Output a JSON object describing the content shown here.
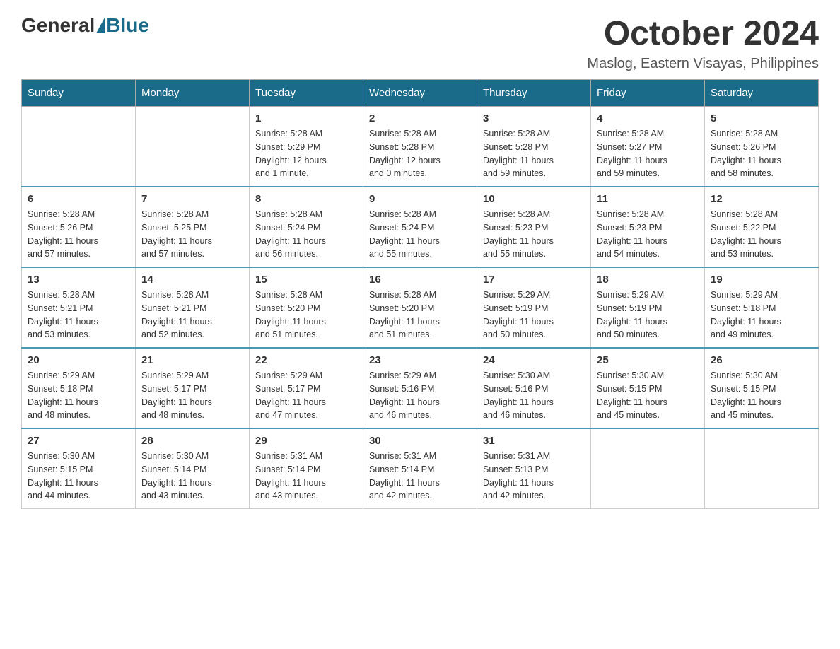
{
  "header": {
    "logo_general": "General",
    "logo_blue": "Blue",
    "month_year": "October 2024",
    "location": "Maslog, Eastern Visayas, Philippines"
  },
  "days_of_week": [
    "Sunday",
    "Monday",
    "Tuesday",
    "Wednesday",
    "Thursday",
    "Friday",
    "Saturday"
  ],
  "weeks": [
    [
      {
        "day": "",
        "info": ""
      },
      {
        "day": "",
        "info": ""
      },
      {
        "day": "1",
        "info": "Sunrise: 5:28 AM\nSunset: 5:29 PM\nDaylight: 12 hours\nand 1 minute."
      },
      {
        "day": "2",
        "info": "Sunrise: 5:28 AM\nSunset: 5:28 PM\nDaylight: 12 hours\nand 0 minutes."
      },
      {
        "day": "3",
        "info": "Sunrise: 5:28 AM\nSunset: 5:28 PM\nDaylight: 11 hours\nand 59 minutes."
      },
      {
        "day": "4",
        "info": "Sunrise: 5:28 AM\nSunset: 5:27 PM\nDaylight: 11 hours\nand 59 minutes."
      },
      {
        "day": "5",
        "info": "Sunrise: 5:28 AM\nSunset: 5:26 PM\nDaylight: 11 hours\nand 58 minutes."
      }
    ],
    [
      {
        "day": "6",
        "info": "Sunrise: 5:28 AM\nSunset: 5:26 PM\nDaylight: 11 hours\nand 57 minutes."
      },
      {
        "day": "7",
        "info": "Sunrise: 5:28 AM\nSunset: 5:25 PM\nDaylight: 11 hours\nand 57 minutes."
      },
      {
        "day": "8",
        "info": "Sunrise: 5:28 AM\nSunset: 5:24 PM\nDaylight: 11 hours\nand 56 minutes."
      },
      {
        "day": "9",
        "info": "Sunrise: 5:28 AM\nSunset: 5:24 PM\nDaylight: 11 hours\nand 55 minutes."
      },
      {
        "day": "10",
        "info": "Sunrise: 5:28 AM\nSunset: 5:23 PM\nDaylight: 11 hours\nand 55 minutes."
      },
      {
        "day": "11",
        "info": "Sunrise: 5:28 AM\nSunset: 5:23 PM\nDaylight: 11 hours\nand 54 minutes."
      },
      {
        "day": "12",
        "info": "Sunrise: 5:28 AM\nSunset: 5:22 PM\nDaylight: 11 hours\nand 53 minutes."
      }
    ],
    [
      {
        "day": "13",
        "info": "Sunrise: 5:28 AM\nSunset: 5:21 PM\nDaylight: 11 hours\nand 53 minutes."
      },
      {
        "day": "14",
        "info": "Sunrise: 5:28 AM\nSunset: 5:21 PM\nDaylight: 11 hours\nand 52 minutes."
      },
      {
        "day": "15",
        "info": "Sunrise: 5:28 AM\nSunset: 5:20 PM\nDaylight: 11 hours\nand 51 minutes."
      },
      {
        "day": "16",
        "info": "Sunrise: 5:28 AM\nSunset: 5:20 PM\nDaylight: 11 hours\nand 51 minutes."
      },
      {
        "day": "17",
        "info": "Sunrise: 5:29 AM\nSunset: 5:19 PM\nDaylight: 11 hours\nand 50 minutes."
      },
      {
        "day": "18",
        "info": "Sunrise: 5:29 AM\nSunset: 5:19 PM\nDaylight: 11 hours\nand 50 minutes."
      },
      {
        "day": "19",
        "info": "Sunrise: 5:29 AM\nSunset: 5:18 PM\nDaylight: 11 hours\nand 49 minutes."
      }
    ],
    [
      {
        "day": "20",
        "info": "Sunrise: 5:29 AM\nSunset: 5:18 PM\nDaylight: 11 hours\nand 48 minutes."
      },
      {
        "day": "21",
        "info": "Sunrise: 5:29 AM\nSunset: 5:17 PM\nDaylight: 11 hours\nand 48 minutes."
      },
      {
        "day": "22",
        "info": "Sunrise: 5:29 AM\nSunset: 5:17 PM\nDaylight: 11 hours\nand 47 minutes."
      },
      {
        "day": "23",
        "info": "Sunrise: 5:29 AM\nSunset: 5:16 PM\nDaylight: 11 hours\nand 46 minutes."
      },
      {
        "day": "24",
        "info": "Sunrise: 5:30 AM\nSunset: 5:16 PM\nDaylight: 11 hours\nand 46 minutes."
      },
      {
        "day": "25",
        "info": "Sunrise: 5:30 AM\nSunset: 5:15 PM\nDaylight: 11 hours\nand 45 minutes."
      },
      {
        "day": "26",
        "info": "Sunrise: 5:30 AM\nSunset: 5:15 PM\nDaylight: 11 hours\nand 45 minutes."
      }
    ],
    [
      {
        "day": "27",
        "info": "Sunrise: 5:30 AM\nSunset: 5:15 PM\nDaylight: 11 hours\nand 44 minutes."
      },
      {
        "day": "28",
        "info": "Sunrise: 5:30 AM\nSunset: 5:14 PM\nDaylight: 11 hours\nand 43 minutes."
      },
      {
        "day": "29",
        "info": "Sunrise: 5:31 AM\nSunset: 5:14 PM\nDaylight: 11 hours\nand 43 minutes."
      },
      {
        "day": "30",
        "info": "Sunrise: 5:31 AM\nSunset: 5:14 PM\nDaylight: 11 hours\nand 42 minutes."
      },
      {
        "day": "31",
        "info": "Sunrise: 5:31 AM\nSunset: 5:13 PM\nDaylight: 11 hours\nand 42 minutes."
      },
      {
        "day": "",
        "info": ""
      },
      {
        "day": "",
        "info": ""
      }
    ]
  ]
}
